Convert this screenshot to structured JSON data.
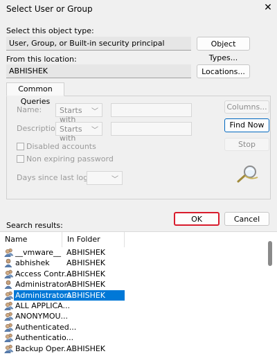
{
  "window": {
    "title": "Select User or Group"
  },
  "object_type": {
    "label": "Select this object type:",
    "value": "User, Group, or Built-in security principal",
    "button": "Object Types..."
  },
  "location": {
    "label": "From this location:",
    "value": "ABHISHEK",
    "button": "Locations..."
  },
  "common_queries": {
    "tab_label": "Common Queries",
    "name_label": "Name:",
    "name_op": "Starts with",
    "description_label": "Description:",
    "description_op": "Starts with",
    "disabled_accounts": "Disabled accounts",
    "non_expiring_password": "Non expiring password",
    "days_since_logon": "Days since last logon:",
    "columns_button": "Columns...",
    "find_now_button": "Find Now",
    "stop_button": "Stop"
  },
  "actions": {
    "ok": "OK",
    "cancel": "Cancel"
  },
  "results": {
    "label": "Search results:",
    "columns": [
      "Name",
      "In Folder"
    ],
    "rows": [
      {
        "name": "__vmware__",
        "folder": "ABHISHEK",
        "icon": "group-icon"
      },
      {
        "name": "abhishek",
        "folder": "ABHISHEK",
        "icon": "user-icon"
      },
      {
        "name": "Access Contr...",
        "folder": "ABHISHEK",
        "icon": "group-icon"
      },
      {
        "name": "Administrator",
        "folder": "ABHISHEK",
        "icon": "user-icon"
      },
      {
        "name": "Administrators",
        "folder": "ABHISHEK",
        "icon": "group-icon",
        "selected": true
      },
      {
        "name": "ALL APPLICA...",
        "folder": "",
        "icon": "group-icon"
      },
      {
        "name": "ANONYMOU...",
        "folder": "",
        "icon": "group-icon"
      },
      {
        "name": "Authenticated...",
        "folder": "",
        "icon": "group-icon"
      },
      {
        "name": "Authenticatio...",
        "folder": "",
        "icon": "group-icon"
      },
      {
        "name": "Backup Oper...",
        "folder": "ABHISHEK",
        "icon": "group-icon"
      }
    ]
  },
  "colors": {
    "accent": "#0078d7",
    "ok_border": "#d81b2c",
    "find_border": "#0067c0"
  }
}
